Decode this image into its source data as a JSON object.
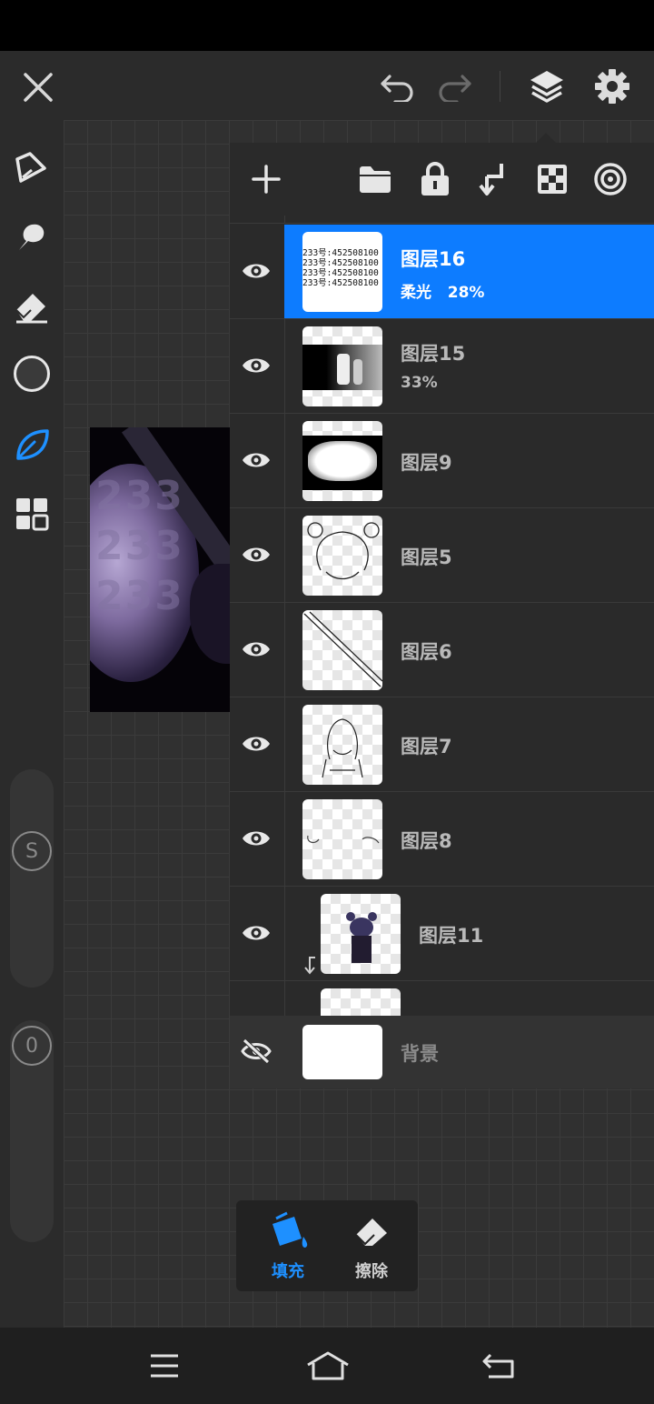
{
  "toolbar": {
    "close": "close-icon",
    "undo": "undo-icon",
    "redo": "redo-icon",
    "layers": "layers-icon",
    "settings": "gear-icon"
  },
  "left_tools": [
    "pen-icon",
    "smudge-icon",
    "eraser-icon",
    "color-swatch",
    "leaf-brush-icon",
    "grid-icon"
  ],
  "sliders": {
    "size_label": "S",
    "opacity_label": "0"
  },
  "artwork": {
    "watermark_text": "233"
  },
  "layer_panel": {
    "actions": [
      "add-icon",
      "folder-icon",
      "lock-icon",
      "merge-down-icon",
      "transparency-icon",
      "blend-icon"
    ],
    "layers": [
      {
        "name": "图层16",
        "blend": "柔光",
        "opacity": "28%",
        "selected": true,
        "visible": true,
        "thumb_text": [
          "233号:452508100",
          "233号:452508100",
          "233号:452508100",
          "233号:452508100"
        ]
      },
      {
        "name": "图层15",
        "blend": "",
        "opacity": "33%",
        "selected": false,
        "visible": true
      },
      {
        "name": "图层9",
        "blend": "",
        "opacity": "",
        "selected": false,
        "visible": true
      },
      {
        "name": "图层5",
        "blend": "",
        "opacity": "",
        "selected": false,
        "visible": true
      },
      {
        "name": "图层6",
        "blend": "",
        "opacity": "",
        "selected": false,
        "visible": true
      },
      {
        "name": "图层7",
        "blend": "",
        "opacity": "",
        "selected": false,
        "visible": true
      },
      {
        "name": "图层8",
        "blend": "",
        "opacity": "",
        "selected": false,
        "visible": true
      },
      {
        "name": "图层11",
        "blend": "",
        "opacity": "",
        "selected": false,
        "visible": true,
        "clipped": true
      }
    ],
    "background": {
      "name": "背景",
      "visible": false
    }
  },
  "fill_tools": {
    "fill_label": "填充",
    "erase_label": "擦除"
  },
  "accent_color": "#0d7cff"
}
